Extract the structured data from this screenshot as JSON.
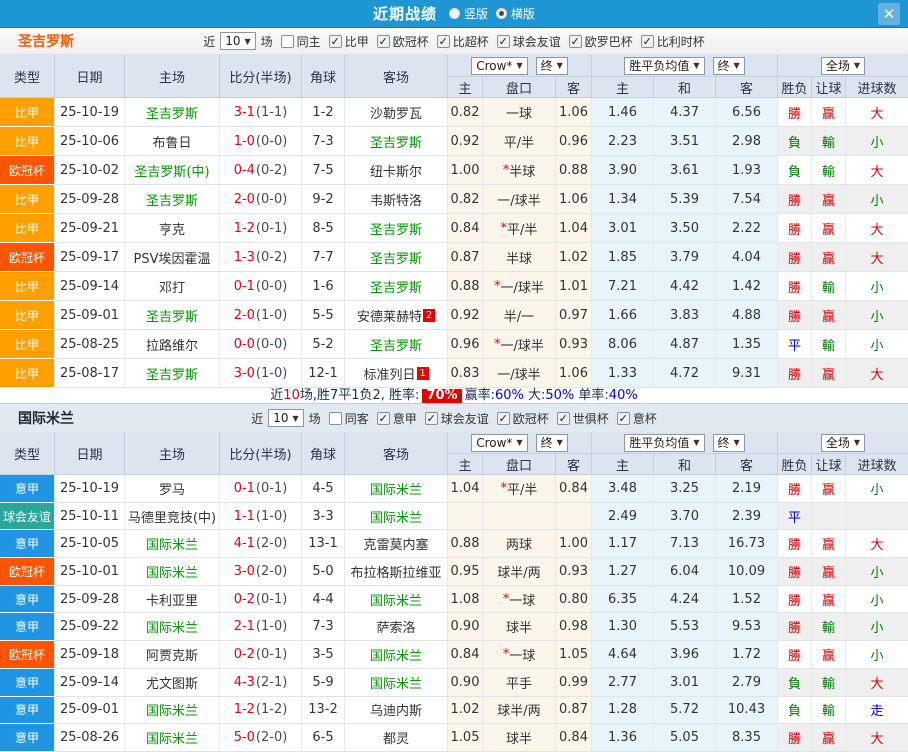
{
  "titlebar": {
    "title": "近期战绩",
    "radio_vertical": "竖版",
    "radio_horizontal": "横版",
    "vertical_checked": false,
    "horizontal_checked": true,
    "close": "✕"
  },
  "columns": {
    "type": "类型",
    "date": "日期",
    "home": "主场",
    "score": "比分(半场)",
    "corner": "角球",
    "away": "客场",
    "odds_home": "主",
    "odds_handicap": "盘口",
    "odds_away": "客",
    "avg_home": "主",
    "avg_draw": "和",
    "avg_away": "客",
    "res_wdl": "胜负",
    "res_handicap": "让球",
    "res_goals": "进球数"
  },
  "dropdowns": {
    "crow": "Crow*",
    "final": "终",
    "avg": "胜平负均值",
    "final2": "终",
    "full": "全场"
  },
  "type_colors": {
    "比甲": "#ffa000",
    "欧冠杯": "#ff5400",
    "意甲": "#2095e4",
    "球会友谊": "#2aa79b"
  },
  "sections": [
    {
      "team": "圣吉罗斯",
      "team_color": "#ff5a00",
      "filter": {
        "near": "近",
        "count": "10",
        "games": "场",
        "same_label": "同主",
        "same_checked": false,
        "leagues": [
          "比甲",
          "欧冠杯",
          "比超杯",
          "球会友谊",
          "欧罗巴杯",
          "比利时杯"
        ]
      },
      "rows": [
        {
          "lg": "比甲",
          "dt": "25-10-19",
          "hm": "圣吉罗斯",
          "hmHL": true,
          "aw": "沙勒罗瓦",
          "awHL": false,
          "awBadge": "",
          "ft": "3-1",
          "ht": "(1-1)",
          "cn": "1-2",
          "oH": "0.82",
          "pan": "一球",
          "oA": "1.06",
          "avgW": "1.46",
          "avgD": "4.37",
          "avgL": "6.56",
          "rW": "勝",
          "rH": "赢",
          "rG": "大"
        },
        {
          "lg": "比甲",
          "dt": "25-10-06",
          "hm": "布鲁日",
          "hmHL": false,
          "aw": "圣吉罗斯",
          "awHL": true,
          "awBadge": "",
          "ft": "1-0",
          "ht": "(0-0)",
          "cn": "7-3",
          "oH": "0.92",
          "pan": "平/半",
          "oA": "0.96",
          "avgW": "2.23",
          "avgD": "3.51",
          "avgL": "2.98",
          "rW": "負",
          "rH": "輸",
          "rG": "小"
        },
        {
          "lg": "欧冠杯",
          "dt": "25-10-02",
          "hm": "圣吉罗斯(中)",
          "hmHL": true,
          "aw": "纽卡斯尔",
          "awHL": false,
          "awBadge": "",
          "ft": "0-4",
          "ht": "(0-2)",
          "cn": "7-5",
          "oH": "1.00",
          "pan": "*半球",
          "oA": "0.88",
          "avgW": "3.90",
          "avgD": "3.61",
          "avgL": "1.93",
          "rW": "負",
          "rH": "輸",
          "rG": "大"
        },
        {
          "lg": "比甲",
          "dt": "25-09-28",
          "hm": "圣吉罗斯",
          "hmHL": true,
          "aw": "韦斯特洛",
          "awHL": false,
          "awBadge": "",
          "ft": "2-0",
          "ht": "(0-0)",
          "cn": "9-2",
          "oH": "0.82",
          "pan": "一/球半",
          "oA": "1.06",
          "avgW": "1.34",
          "avgD": "5.39",
          "avgL": "7.54",
          "rW": "勝",
          "rH": "赢",
          "rG": "小"
        },
        {
          "lg": "比甲",
          "dt": "25-09-21",
          "hm": "亨克",
          "hmHL": false,
          "aw": "圣吉罗斯",
          "awHL": true,
          "awBadge": "",
          "ft": "1-2",
          "ht": "(0-1)",
          "cn": "8-5",
          "oH": "0.84",
          "pan": "*平/半",
          "oA": "1.04",
          "avgW": "3.01",
          "avgD": "3.50",
          "avgL": "2.22",
          "rW": "勝",
          "rH": "赢",
          "rG": "大"
        },
        {
          "lg": "欧冠杯",
          "dt": "25-09-17",
          "hm": "PSV埃因霍温",
          "hmHL": false,
          "aw": "圣吉罗斯",
          "awHL": true,
          "awBadge": "",
          "ft": "1-3",
          "ht": "(0-2)",
          "cn": "7-7",
          "oH": "0.87",
          "pan": "半球",
          "oA": "1.02",
          "avgW": "1.85",
          "avgD": "3.79",
          "avgL": "4.04",
          "rW": "勝",
          "rH": "赢",
          "rG": "大"
        },
        {
          "lg": "比甲",
          "dt": "25-09-14",
          "hm": "邓打",
          "hmHL": false,
          "aw": "圣吉罗斯",
          "awHL": true,
          "awBadge": "",
          "ft": "0-1",
          "ht": "(0-0)",
          "cn": "1-6",
          "oH": "0.88",
          "pan": "*一/球半",
          "oA": "1.01",
          "avgW": "7.21",
          "avgD": "4.42",
          "avgL": "1.42",
          "rW": "勝",
          "rH": "輸",
          "rG": "小"
        },
        {
          "lg": "比甲",
          "dt": "25-09-01",
          "hm": "圣吉罗斯",
          "hmHL": true,
          "aw": "安德莱赫特",
          "awHL": false,
          "awBadge": "2",
          "ft": "2-0",
          "ht": "(1-0)",
          "cn": "5-5",
          "oH": "0.92",
          "pan": "半/一",
          "oA": "0.97",
          "avgW": "1.66",
          "avgD": "3.83",
          "avgL": "4.88",
          "rW": "勝",
          "rH": "赢",
          "rG": "小"
        },
        {
          "lg": "比甲",
          "dt": "25-08-25",
          "hm": "拉路维尔",
          "hmHL": false,
          "aw": "圣吉罗斯",
          "awHL": true,
          "awBadge": "",
          "ft": "0-0",
          "ht": "(0-0)",
          "cn": "5-2",
          "oH": "0.96",
          "pan": "*一/球半",
          "oA": "0.93",
          "avgW": "8.06",
          "avgD": "4.87",
          "avgL": "1.35",
          "rW": "平",
          "rH": "輸",
          "rG": "小"
        },
        {
          "lg": "比甲",
          "dt": "25-08-17",
          "hm": "圣吉罗斯",
          "hmHL": true,
          "aw": "标准列日",
          "awHL": false,
          "awBadge": "1",
          "ft": "3-0",
          "ht": "(1-0)",
          "cn": "12-1",
          "oH": "0.83",
          "pan": "一/球半",
          "oA": "1.06",
          "avgW": "1.33",
          "avgD": "4.72",
          "avgL": "9.31",
          "rW": "勝",
          "rH": "赢",
          "rG": "大"
        }
      ],
      "summary": [
        {
          "t": "近",
          "c": "plain"
        },
        {
          "t": "10",
          "c": "red"
        },
        {
          "t": "场,胜7平1负2, 胜率:",
          "c": "plain"
        },
        {
          "t": "70%",
          "c": "badge"
        },
        {
          "t": "赢率:",
          "c": "plain"
        },
        {
          "t": "60%",
          "c": "blue"
        },
        {
          "t": " 大:",
          "c": "plain"
        },
        {
          "t": "50%",
          "c": "blue"
        },
        {
          "t": " 单率:",
          "c": "plain"
        },
        {
          "t": "40%",
          "c": "blue"
        }
      ]
    },
    {
      "team": "国际米兰",
      "team_color": "#1f2733",
      "filter": {
        "near": "近",
        "count": "10",
        "games": "场",
        "same_label": "同客",
        "same_checked": false,
        "leagues": [
          "意甲",
          "球会友谊",
          "欧冠杯",
          "世俱杯",
          "意杯"
        ]
      },
      "rows": [
        {
          "lg": "意甲",
          "dt": "25-10-19",
          "hm": "罗马",
          "hmHL": false,
          "aw": "国际米兰",
          "awHL": true,
          "awBadge": "",
          "ft": "0-1",
          "ht": "(0-1)",
          "cn": "4-5",
          "oH": "1.04",
          "pan": "*平/半",
          "oA": "0.84",
          "avgW": "3.48",
          "avgD": "3.25",
          "avgL": "2.19",
          "rW": "勝",
          "rH": "赢",
          "rG": "小"
        },
        {
          "lg": "球会友谊",
          "dt": "25-10-11",
          "hm": "马德里竞技(中)",
          "hmHL": false,
          "aw": "国际米兰",
          "awHL": true,
          "awBadge": "",
          "ft": "1-1",
          "ht": "(1-0)",
          "cn": "3-3",
          "oH": "",
          "pan": "",
          "oA": "",
          "avgW": "2.49",
          "avgD": "3.70",
          "avgL": "2.39",
          "rW": "平",
          "rH": "",
          "rG": ""
        },
        {
          "lg": "意甲",
          "dt": "25-10-05",
          "hm": "国际米兰",
          "hmHL": true,
          "aw": "克雷莫内塞",
          "awHL": false,
          "awBadge": "",
          "ft": "4-1",
          "ht": "(2-0)",
          "cn": "13-1",
          "oH": "0.88",
          "pan": "两球",
          "oA": "1.00",
          "avgW": "1.17",
          "avgD": "7.13",
          "avgL": "16.73",
          "rW": "勝",
          "rH": "赢",
          "rG": "大"
        },
        {
          "lg": "欧冠杯",
          "dt": "25-10-01",
          "hm": "国际米兰",
          "hmHL": true,
          "aw": "布拉格斯拉维亚",
          "awHL": false,
          "awBadge": "",
          "ft": "3-0",
          "ht": "(2-0)",
          "cn": "5-0",
          "oH": "0.95",
          "pan": "球半/两",
          "oA": "0.93",
          "avgW": "1.27",
          "avgD": "6.04",
          "avgL": "10.09",
          "rW": "勝",
          "rH": "赢",
          "rG": "小"
        },
        {
          "lg": "意甲",
          "dt": "25-09-28",
          "hm": "卡利亚里",
          "hmHL": false,
          "aw": "国际米兰",
          "awHL": true,
          "awBadge": "",
          "ft": "0-2",
          "ht": "(0-1)",
          "cn": "4-4",
          "oH": "1.08",
          "pan": "*一球",
          "oA": "0.80",
          "avgW": "6.35",
          "avgD": "4.24",
          "avgL": "1.52",
          "rW": "勝",
          "rH": "赢",
          "rG": "小"
        },
        {
          "lg": "意甲",
          "dt": "25-09-22",
          "hm": "国际米兰",
          "hmHL": true,
          "aw": "萨索洛",
          "awHL": false,
          "awBadge": "",
          "ft": "2-1",
          "ht": "(1-0)",
          "cn": "7-3",
          "oH": "0.90",
          "pan": "球半",
          "oA": "0.98",
          "avgW": "1.30",
          "avgD": "5.53",
          "avgL": "9.53",
          "rW": "勝",
          "rH": "輸",
          "rG": "小"
        },
        {
          "lg": "欧冠杯",
          "dt": "25-09-18",
          "hm": "阿贾克斯",
          "hmHL": false,
          "aw": "国际米兰",
          "awHL": true,
          "awBadge": "",
          "ft": "0-2",
          "ht": "(0-1)",
          "cn": "3-5",
          "oH": "0.84",
          "pan": "*一球",
          "oA": "1.05",
          "avgW": "4.64",
          "avgD": "3.96",
          "avgL": "1.72",
          "rW": "勝",
          "rH": "赢",
          "rG": "小"
        },
        {
          "lg": "意甲",
          "dt": "25-09-14",
          "hm": "尤文图斯",
          "hmHL": false,
          "aw": "国际米兰",
          "awHL": true,
          "awBadge": "",
          "ft": "4-3",
          "ht": "(2-1)",
          "cn": "5-9",
          "oH": "0.90",
          "pan": "平手",
          "oA": "0.99",
          "avgW": "2.77",
          "avgD": "3.01",
          "avgL": "2.79",
          "rW": "負",
          "rH": "輸",
          "rG": "大"
        },
        {
          "lg": "意甲",
          "dt": "25-09-01",
          "hm": "国际米兰",
          "hmHL": true,
          "aw": "乌迪内斯",
          "awHL": false,
          "awBadge": "",
          "ft": "1-2",
          "ht": "(1-2)",
          "cn": "13-2",
          "oH": "1.02",
          "pan": "球半/两",
          "oA": "0.87",
          "avgW": "1.28",
          "avgD": "5.72",
          "avgL": "10.43",
          "rW": "負",
          "rH": "輸",
          "rG": "走"
        },
        {
          "lg": "意甲",
          "dt": "25-08-26",
          "hm": "国际米兰",
          "hmHL": true,
          "aw": "都灵",
          "awHL": false,
          "awBadge": "",
          "ft": "5-0",
          "ht": "(2-0)",
          "cn": "6-5",
          "oH": "1.05",
          "pan": "球半",
          "oA": "0.84",
          "avgW": "1.36",
          "avgD": "5.05",
          "avgL": "8.35",
          "rW": "勝",
          "rH": "赢",
          "rG": "大"
        }
      ],
      "summary": null
    }
  ]
}
